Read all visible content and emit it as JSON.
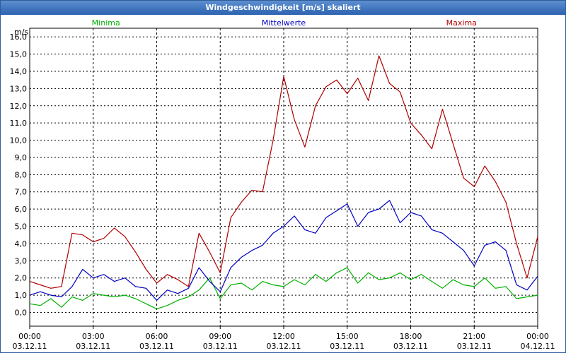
{
  "window": {
    "title": "Windgeschwindigkeit [m/s] skaliert"
  },
  "colors": {
    "minima": "#00b000",
    "mittelwerte": "#0000c0",
    "maxima": "#b00000",
    "grid": "#000000"
  },
  "chart_data": {
    "type": "line",
    "title": "Windgeschwindigkeit [m/s] skaliert",
    "ylabel": "m/s",
    "xlabel": "",
    "ylim": [
      -0.8,
      16.5
    ],
    "xlim": [
      0,
      24
    ],
    "grid": true,
    "legend": "top",
    "x_ticks": [
      {
        "x": 0,
        "time": "00:00",
        "date": "03.12.11"
      },
      {
        "x": 3,
        "time": "03:00",
        "date": "03.12.11"
      },
      {
        "x": 6,
        "time": "06:00",
        "date": "03.12.11"
      },
      {
        "x": 9,
        "time": "09:00",
        "date": "03.12.11"
      },
      {
        "x": 12,
        "time": "12:00",
        "date": "03.12.11"
      },
      {
        "x": 15,
        "time": "15:00",
        "date": "03.12.11"
      },
      {
        "x": 18,
        "time": "18:00",
        "date": "03.12.11"
      },
      {
        "x": 21,
        "time": "21:00",
        "date": "03.12.11"
      },
      {
        "x": 24,
        "time": "00:00",
        "date": "04.12.11"
      }
    ],
    "y_ticks": [
      {
        "v": 0,
        "label": "0,0"
      },
      {
        "v": 1,
        "label": "1,0"
      },
      {
        "v": 2,
        "label": "2,0"
      },
      {
        "v": 3,
        "label": "3,0"
      },
      {
        "v": 4,
        "label": "4,0"
      },
      {
        "v": 5,
        "label": "5,0"
      },
      {
        "v": 6,
        "label": "6,0"
      },
      {
        "v": 7,
        "label": "7,0"
      },
      {
        "v": 8,
        "label": "8,0"
      },
      {
        "v": 9,
        "label": "9,0"
      },
      {
        "v": 10,
        "label": "10,0"
      },
      {
        "v": 11,
        "label": "11,0"
      },
      {
        "v": 12,
        "label": "12,0"
      },
      {
        "v": 13,
        "label": "13,0"
      },
      {
        "v": 14,
        "label": "14,0"
      },
      {
        "v": 15,
        "label": "15,0"
      },
      {
        "v": 16,
        "label": "16,0"
      }
    ],
    "x": [
      0,
      0.5,
      1,
      1.5,
      2,
      2.5,
      3,
      3.5,
      4,
      4.5,
      5,
      5.5,
      6,
      6.5,
      7,
      7.5,
      8,
      8.5,
      9,
      9.5,
      10,
      10.5,
      11,
      11.5,
      12,
      12.5,
      13,
      13.5,
      14,
      14.5,
      15,
      15.5,
      16,
      16.5,
      17,
      17.5,
      18,
      18.5,
      19,
      19.5,
      20,
      20.5,
      21,
      21.5,
      22,
      22.5,
      23,
      23.5,
      24
    ],
    "series": [
      {
        "name": "Minima",
        "color": "#00b000",
        "values": [
          0.5,
          0.4,
          0.8,
          0.3,
          0.9,
          0.7,
          1.1,
          1.0,
          0.9,
          1.0,
          0.8,
          0.5,
          0.2,
          0.4,
          0.7,
          0.9,
          1.3,
          2.0,
          0.8,
          1.6,
          1.7,
          1.3,
          1.8,
          1.6,
          1.5,
          1.9,
          1.6,
          2.2,
          1.8,
          2.3,
          2.6,
          1.7,
          2.3,
          1.9,
          2.0,
          2.3,
          1.9,
          2.2,
          1.8,
          1.4,
          1.9,
          1.6,
          1.5,
          2.0,
          1.4,
          1.5,
          0.8,
          0.9,
          1.0
        ]
      },
      {
        "name": "Mittelwerte",
        "color": "#0000c0",
        "values": [
          1.0,
          1.2,
          1.0,
          0.9,
          1.5,
          2.5,
          2.0,
          2.2,
          1.8,
          2.0,
          1.5,
          1.4,
          0.7,
          1.3,
          1.1,
          1.4,
          2.6,
          1.8,
          1.2,
          2.6,
          3.2,
          3.6,
          3.9,
          4.6,
          5.0,
          5.6,
          4.8,
          4.6,
          5.5,
          5.9,
          6.3,
          5.0,
          5.8,
          6.0,
          6.5,
          5.2,
          5.8,
          5.6,
          4.8,
          4.6,
          4.1,
          3.6,
          2.7,
          3.9,
          4.1,
          3.6,
          1.6,
          1.3,
          2.1
        ]
      },
      {
        "name": "Maxima",
        "color": "#b00000",
        "values": [
          1.8,
          1.6,
          1.4,
          1.5,
          4.6,
          4.5,
          4.1,
          4.3,
          4.9,
          4.4,
          3.5,
          2.5,
          1.7,
          2.2,
          1.9,
          1.5,
          4.6,
          3.5,
          2.3,
          5.5,
          6.4,
          7.1,
          7.0,
          10.0,
          13.7,
          11.2,
          9.6,
          12.0,
          13.1,
          13.5,
          12.7,
          13.6,
          12.3,
          14.9,
          13.3,
          12.8,
          11.0,
          10.3,
          9.5,
          11.8,
          9.8,
          7.8,
          7.3,
          8.5,
          7.6,
          6.4,
          4.0,
          2.0,
          4.4
        ]
      }
    ]
  }
}
